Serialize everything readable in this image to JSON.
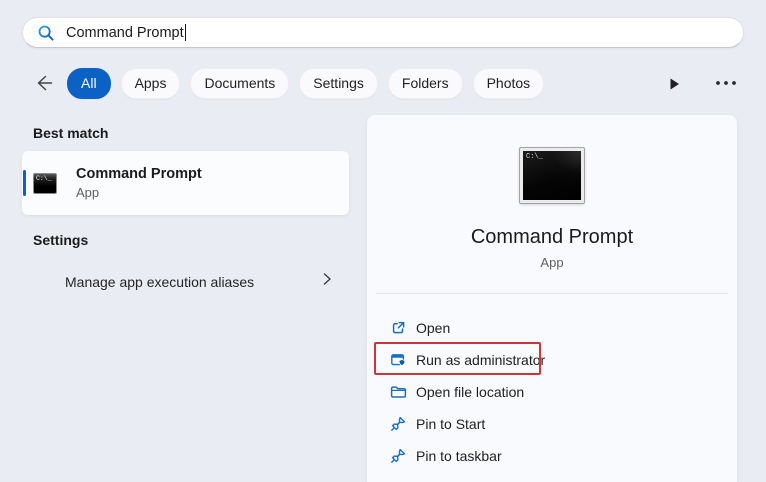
{
  "search": {
    "value": "Command Prompt"
  },
  "filters": {
    "tabs": [
      "All",
      "Apps",
      "Documents",
      "Settings",
      "Folders",
      "Photos"
    ],
    "active_tab": "All"
  },
  "left": {
    "best_match_header": "Best match",
    "best_match": {
      "title": "Command Prompt",
      "subtitle": "App"
    },
    "settings_header": "Settings",
    "settings_item": {
      "label": "Manage app execution aliases"
    }
  },
  "right": {
    "app_title": "Command Prompt",
    "app_subtitle": "App",
    "actions": [
      {
        "label": "Open"
      },
      {
        "label": "Run as administrator",
        "highlighted": true
      },
      {
        "label": "Open file location"
      },
      {
        "label": "Pin to Start"
      },
      {
        "label": "Pin to taskbar"
      }
    ]
  },
  "icons": {
    "terminal_text": "C:\\_",
    "search": "magnifier",
    "back": "left-arrow",
    "play": "filled-right-triangle",
    "more": "three-dots",
    "chevron_right": "thin-right-chevron",
    "open": "external-link-square",
    "run_as_admin": "window-with-shield",
    "open_file_location": "folder-outline",
    "pin": "pushpin-outline"
  },
  "colors": {
    "accent_blue": "#0b61c4",
    "icon_blue": "#1a6fc4",
    "highlight_red": "#d13438",
    "background": "#e9ecf3",
    "panel": "#f9fafd"
  }
}
